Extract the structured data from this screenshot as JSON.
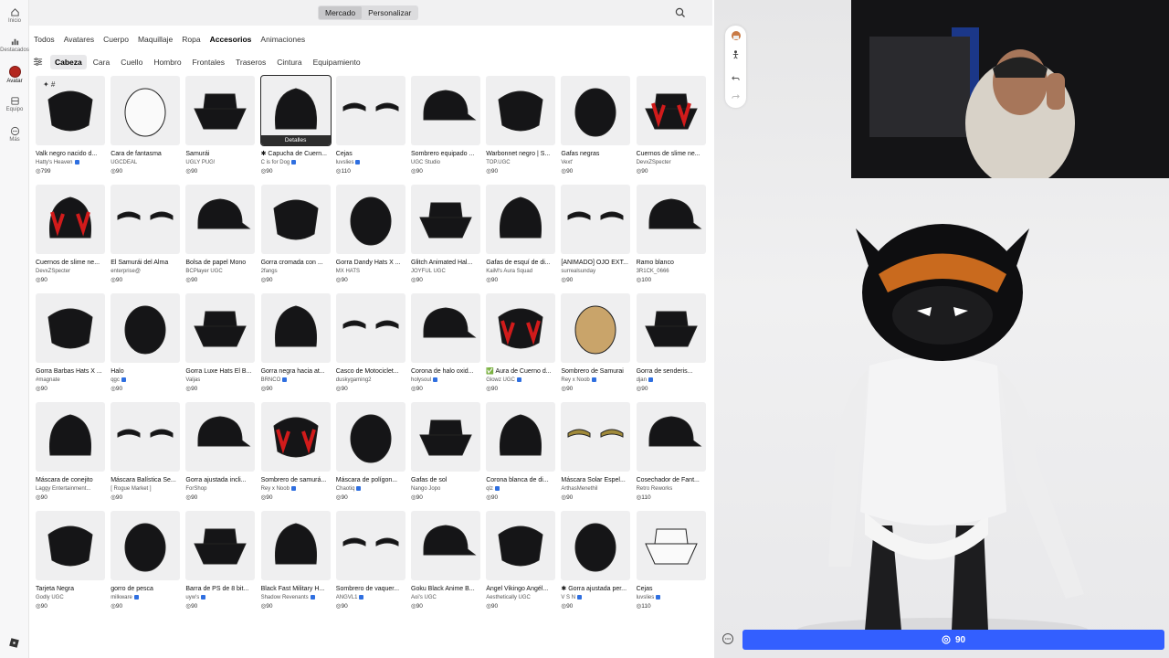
{
  "sidebar": {
    "items": [
      {
        "label": "Inicio",
        "icon": "home-icon"
      },
      {
        "label": "Destacados",
        "icon": "chart-icon"
      },
      {
        "label": "Avatar",
        "icon": "avatar-icon"
      },
      {
        "label": "Equipo",
        "icon": "group-icon"
      },
      {
        "label": "Más",
        "icon": "more-icon"
      }
    ],
    "logo_icon": "roblox-logo-icon"
  },
  "top": {
    "segments": [
      "Mercado",
      "Personalizar"
    ],
    "active_segment": "Mercado",
    "search_icon": "search-icon"
  },
  "category_tabs": [
    "Todos",
    "Avatares",
    "Cuerpo",
    "Maquillaje",
    "Ropa",
    "Accesorios",
    "Animaciones"
  ],
  "active_category": "Accesorios",
  "sub_tabs": [
    "Cabeza",
    "Cara",
    "Cuello",
    "Hombro",
    "Frontales",
    "Traseros",
    "Cintura",
    "Equipamiento"
  ],
  "active_sub_tab": "Cabeza",
  "hover_label": "Detalles",
  "new_tag": "✦ #",
  "items": [
    {
      "name": "Valk negro nacido d...",
      "creator": "Hatty's Heaven",
      "verified": true,
      "price": "799"
    },
    {
      "name": "Cara de fantasma",
      "creator": "UGCDEAL",
      "verified": false,
      "price": "90"
    },
    {
      "name": "Samurái",
      "creator": "UGLY PUG!",
      "verified": false,
      "price": "90"
    },
    {
      "name": "✱ Capucha de Cuern...",
      "creator": "C is for Dog",
      "verified": true,
      "price": "90"
    },
    {
      "name": "Cejas",
      "creator": "luvslies",
      "verified": true,
      "price": "110"
    },
    {
      "name": "Sombrero equipado ...",
      "creator": "UGC Studio",
      "verified": false,
      "price": "90"
    },
    {
      "name": "Warbonnet negro | S...",
      "creator": "TOP.UGC",
      "verified": false,
      "price": "90"
    },
    {
      "name": "Gafas negras",
      "creator": "Vext'",
      "verified": false,
      "price": "90"
    },
    {
      "name": "Cuernos de slime ne...",
      "creator": "DevxZSpecter",
      "verified": false,
      "price": "90"
    },
    {
      "name": "Cuernos de slime ne...",
      "creator": "DevxZSpecter",
      "verified": false,
      "price": "90"
    },
    {
      "name": "El Samurái del Alma",
      "creator": "enterprise@",
      "verified": false,
      "price": "90"
    },
    {
      "name": "Bolsa de papel Mono",
      "creator": "BCPlayer UGC",
      "verified": false,
      "price": "90"
    },
    {
      "name": "Gorra cromada con ...",
      "creator": "2fangs",
      "verified": false,
      "price": "90"
    },
    {
      "name": "Gorra Dandy Hats X ...",
      "creator": "MX HATS",
      "verified": false,
      "price": "90"
    },
    {
      "name": "Glitch Animated Hal...",
      "creator": "JOYFUL UGC",
      "verified": false,
      "price": "90"
    },
    {
      "name": "Gafas de esquí de di...",
      "creator": "KaiM's Aura Squad",
      "verified": false,
      "price": "90"
    },
    {
      "name": "[ANIMADO] OJO EXT...",
      "creator": "surrealsunday",
      "verified": false,
      "price": "90"
    },
    {
      "name": "Ramo blanco",
      "creator": "3R1CK_0666",
      "verified": false,
      "price": "100"
    },
    {
      "name": "Gorra Barbas Hats X ...",
      "creator": "#magnate",
      "verified": false,
      "price": "90"
    },
    {
      "name": "Halo",
      "creator": "qgc",
      "verified": true,
      "price": "90"
    },
    {
      "name": "Gorra Luxe Hats El B...",
      "creator": "Valjas",
      "verified": false,
      "price": "90"
    },
    {
      "name": "Gorra negra hacia at...",
      "creator": "BRNCO",
      "verified": true,
      "price": "90"
    },
    {
      "name": "Casco de Motociclet...",
      "creator": "duskygaming2",
      "verified": false,
      "price": "90"
    },
    {
      "name": "Corona de halo oxid...",
      "creator": "holysoul",
      "verified": true,
      "price": "90"
    },
    {
      "name": "✅ Aura de Cuerno d...",
      "creator": "Glowz UGC",
      "verified": true,
      "price": "90"
    },
    {
      "name": "Sombrero de Samurai",
      "creator": "Rey x Noob",
      "verified": true,
      "price": "90"
    },
    {
      "name": "Gorra de senderis...",
      "creator": "djan",
      "verified": true,
      "price": "90"
    },
    {
      "name": "Máscara de conejito",
      "creator": "Laggy Entertainment...",
      "verified": false,
      "price": "90"
    },
    {
      "name": "Máscara Balística Se...",
      "creator": "[ Rogue Market ]",
      "verified": false,
      "price": "90"
    },
    {
      "name": "Gorra ajustada incli...",
      "creator": "ForShop",
      "verified": false,
      "price": "90"
    },
    {
      "name": "Sombrero de samurá...",
      "creator": "Rey x Noob",
      "verified": true,
      "price": "90"
    },
    {
      "name": "Máscara de polígon...",
      "creator": "Chaotiq",
      "verified": true,
      "price": "90"
    },
    {
      "name": "Gafas de sol",
      "creator": "Ñango Jopo",
      "verified": false,
      "price": "90"
    },
    {
      "name": "Corona blanca de di...",
      "creator": "qlz",
      "verified": true,
      "price": "90"
    },
    {
      "name": "Máscara Solar Espel...",
      "creator": "ArthasMenethil",
      "verified": false,
      "price": "90"
    },
    {
      "name": "Cosechador de Fant...",
      "creator": "Retro Reworks",
      "verified": false,
      "price": "110"
    },
    {
      "name": "Tarjeta Negra",
      "creator": "Godly UGC",
      "verified": false,
      "price": "90"
    },
    {
      "name": "gorro de pesca",
      "creator": "milkware",
      "verified": true,
      "price": "90"
    },
    {
      "name": "Barra de PS de 8 bit...",
      "creator": "uyw's",
      "verified": true,
      "price": "90"
    },
    {
      "name": "Black Fast Military H...",
      "creator": "Shadow Revenants",
      "verified": true,
      "price": "90"
    },
    {
      "name": "Sombrero de vaquer...",
      "creator": "ANGVL1",
      "verified": true,
      "price": "90"
    },
    {
      "name": "Goku Black Anime B...",
      "creator": "Aoi's UGC",
      "verified": false,
      "price": "90"
    },
    {
      "name": "Ángel Vikingo Angél...",
      "creator": "Aesthetically UGC",
      "verified": false,
      "price": "90"
    },
    {
      "name": "✱ Gorra ajustada per...",
      "creator": "V S N",
      "verified": true,
      "price": "90"
    },
    {
      "name": "Cejas",
      "creator": "luvslies",
      "verified": true,
      "price": "110"
    }
  ],
  "preview": {
    "tool_icons": [
      "avatar-thumb-icon",
      "pose-icon",
      "undo-icon",
      "redo-icon"
    ],
    "chat_icon": "chat-icon",
    "buy_price": "90",
    "robux_icon": "robux-icon"
  },
  "colors": {
    "accent": "#335fff",
    "verified": "#2f6fe0"
  }
}
